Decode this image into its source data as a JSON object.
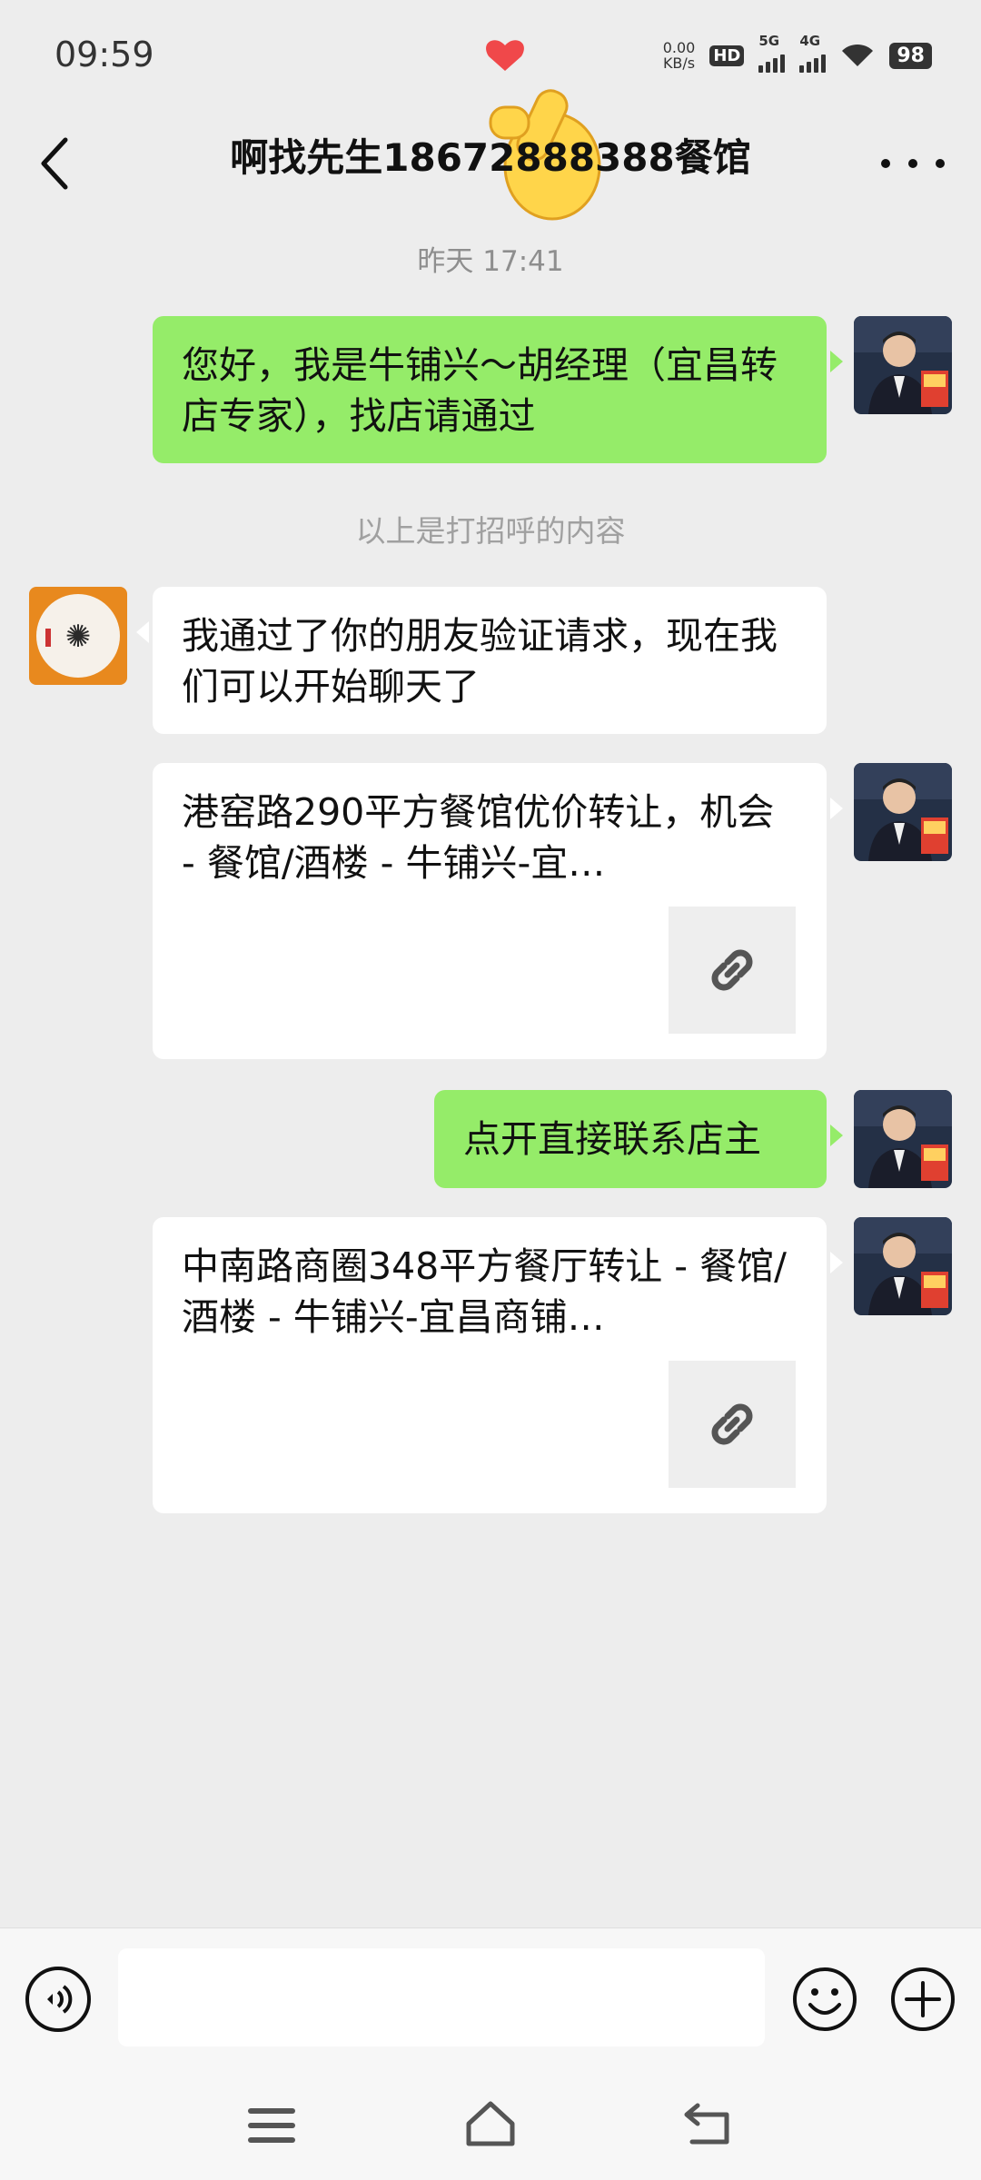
{
  "status_bar": {
    "time": "09:59",
    "net_speed_value": "0.00",
    "net_speed_unit": "KB/s",
    "hd_label": "HD",
    "signal1_label": "5G",
    "signal2_label": "4G",
    "battery": "98"
  },
  "header": {
    "title": "啊找先生18672888388餐馆",
    "back_icon": "chevron-left-icon",
    "more_icon": "more-dots-icon"
  },
  "chat": {
    "timestamp": "昨天 17:41",
    "system_note": "以上是打招呼的内容",
    "messages": [
      {
        "side": "right",
        "type": "text",
        "text": "您好，我是牛铺兴～胡经理（宜昌转店专家），找店请通过"
      },
      {
        "side": "left",
        "type": "text",
        "text": "我通过了你的朋友验证请求，现在我们可以开始聊天了"
      },
      {
        "side": "right",
        "type": "link",
        "text": "港窑路290平方餐馆优价转让，机会 - 餐馆/酒楼 - 牛铺兴-宜…",
        "icon": "link-icon"
      },
      {
        "side": "right",
        "type": "text",
        "text": "点开直接联系店主"
      },
      {
        "side": "right",
        "type": "link",
        "text": "中南路商圈348平方餐厅转让 - 餐馆/酒楼 - 牛铺兴-宜昌商铺…",
        "icon": "link-icon"
      }
    ]
  },
  "input_bar": {
    "voice_icon": "voice-icon",
    "input_value": "",
    "emoji_icon": "emoji-icon",
    "plus_icon": "plus-icon"
  },
  "system_nav": {
    "menu_icon": "menu-icon",
    "home_icon": "home-icon",
    "back_icon": "back-icon"
  },
  "colors": {
    "background": "#ededed",
    "bubble_self": "#95ec69",
    "bubble_other": "#ffffff",
    "timestamp": "#8e8e8e"
  }
}
